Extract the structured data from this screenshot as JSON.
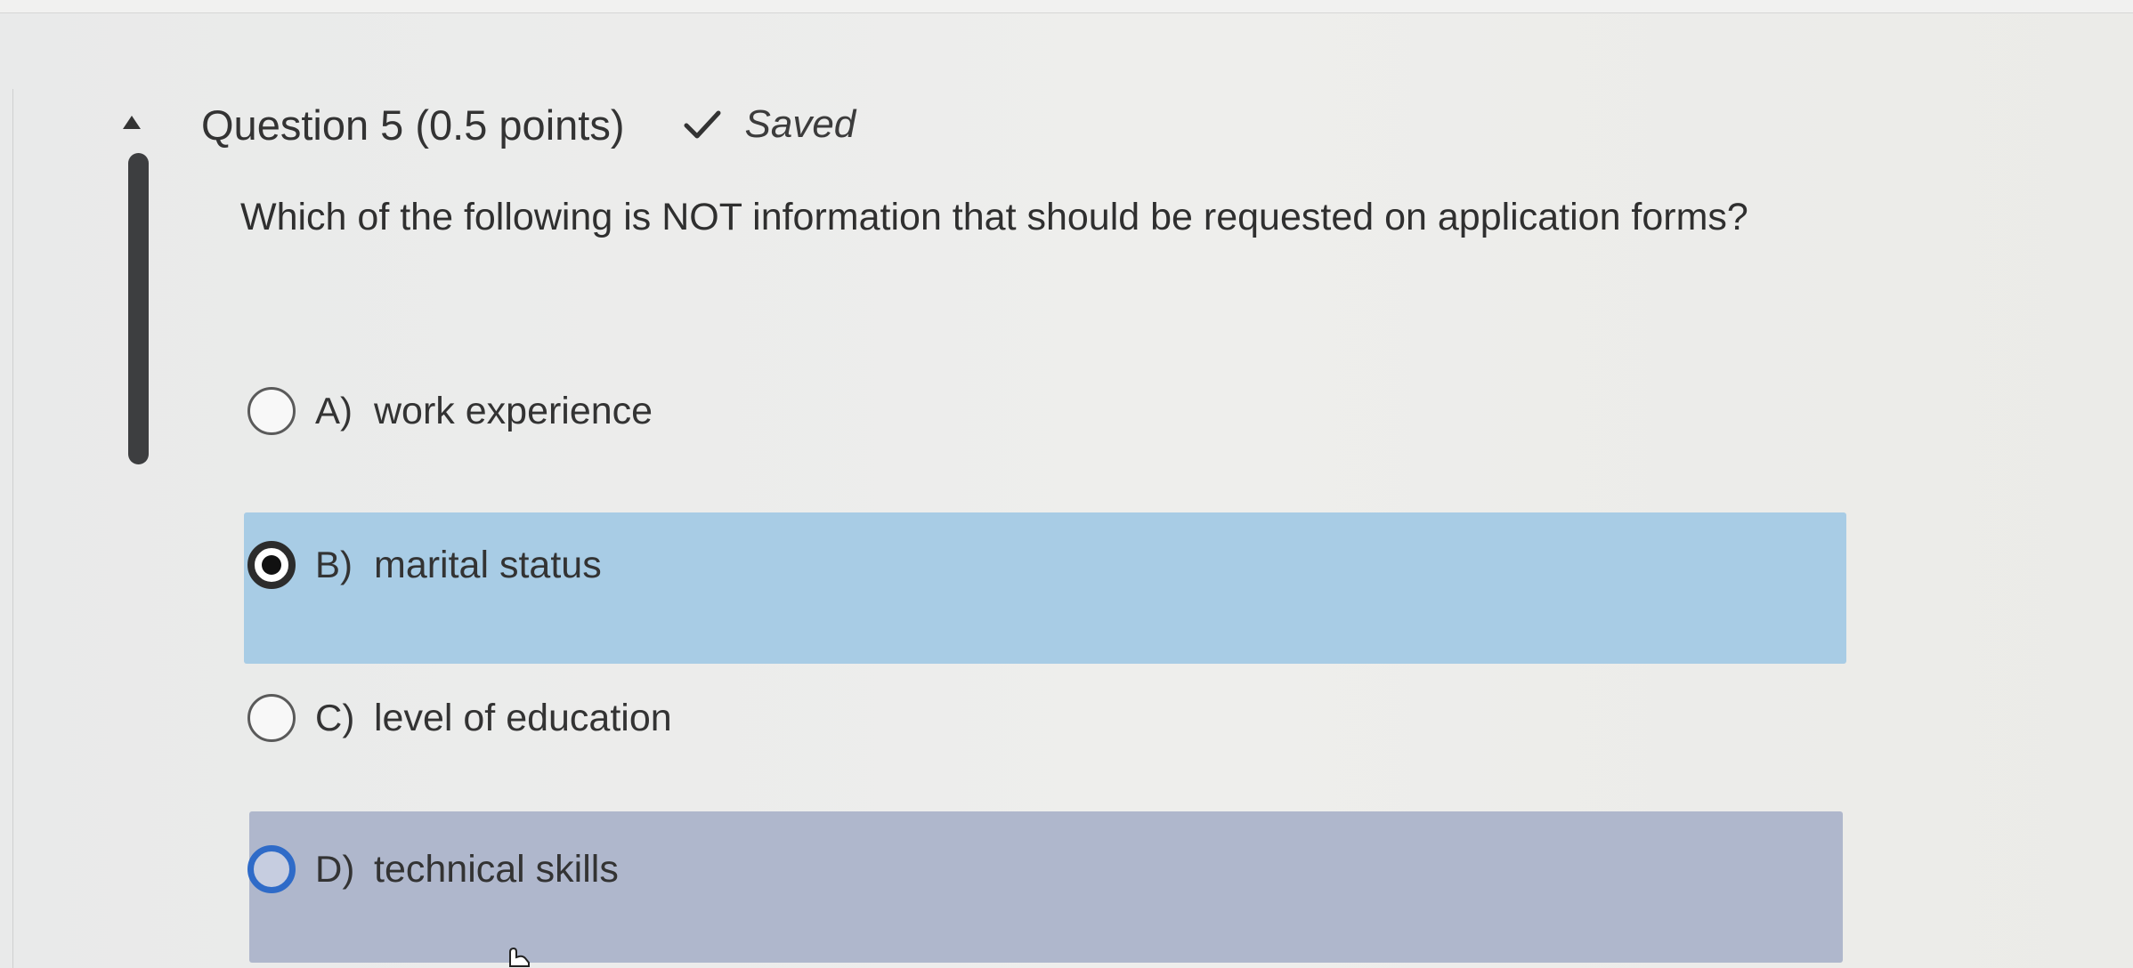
{
  "question": {
    "title": "Question 5 (0.5 points)",
    "status": "Saved",
    "status_icon": "check-icon",
    "text": "Which of the following is NOT information that should be requested on application forms?",
    "selected_option": "B"
  },
  "options": [
    {
      "letter": "A)",
      "text": "work experience",
      "selected": false
    },
    {
      "letter": "B)",
      "text": "marital status",
      "selected": true
    },
    {
      "letter": "C)",
      "text": "level of education",
      "selected": false
    },
    {
      "letter": "D)",
      "text": "technical skills",
      "selected": false
    }
  ],
  "colors": {
    "selected_row": "#a8cce5",
    "hover_row": "#afb7cc",
    "focus_radio": "#2f6bc8",
    "focus_bar": "#3d3e40"
  }
}
